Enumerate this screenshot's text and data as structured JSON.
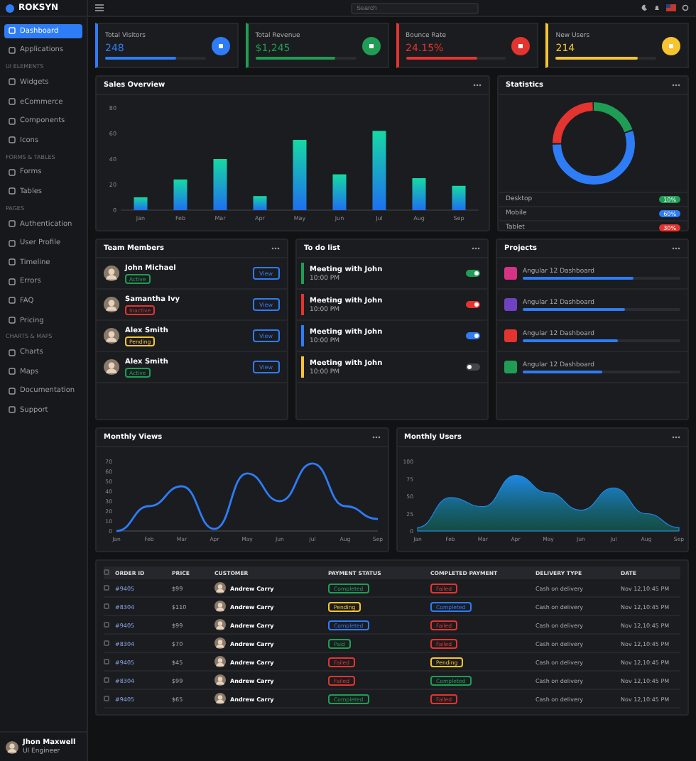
{
  "brand": "ROKSYN",
  "search": {
    "placeholder": "Search"
  },
  "sidebar": {
    "items": [
      {
        "kind": "item",
        "label": "Dashboard",
        "selected": true
      },
      {
        "kind": "item",
        "label": "Applications",
        "selected": false
      },
      {
        "kind": "section",
        "label": "UI ELEMENTS"
      },
      {
        "kind": "item",
        "label": "Widgets",
        "selected": false
      },
      {
        "kind": "item",
        "label": "eCommerce",
        "selected": false
      },
      {
        "kind": "item",
        "label": "Components",
        "selected": false
      },
      {
        "kind": "item",
        "label": "Icons",
        "selected": false
      },
      {
        "kind": "section",
        "label": "FORMS & TABLES"
      },
      {
        "kind": "item",
        "label": "Forms",
        "selected": false
      },
      {
        "kind": "item",
        "label": "Tables",
        "selected": false
      },
      {
        "kind": "section",
        "label": "PAGES"
      },
      {
        "kind": "item",
        "label": "Authentication",
        "selected": false
      },
      {
        "kind": "item",
        "label": "User Profile",
        "selected": false
      },
      {
        "kind": "item",
        "label": "Timeline",
        "selected": false
      },
      {
        "kind": "item",
        "label": "Errors",
        "selected": false
      },
      {
        "kind": "item",
        "label": "FAQ",
        "selected": false
      },
      {
        "kind": "item",
        "label": "Pricing",
        "selected": false
      },
      {
        "kind": "section",
        "label": "CHARTS & MAPS"
      },
      {
        "kind": "item",
        "label": "Charts",
        "selected": false
      },
      {
        "kind": "item",
        "label": "Maps",
        "selected": false
      },
      {
        "kind": "item",
        "label": "Documentation",
        "selected": false
      },
      {
        "kind": "item",
        "label": "Support",
        "selected": false
      }
    ],
    "user": {
      "name": "Jhon Maxwell",
      "role": "UI Engineer"
    }
  },
  "stats": [
    {
      "label": "Total Visitors",
      "value": "248",
      "color": "#2e7cf6",
      "level": 0.7
    },
    {
      "label": "Total Revenue",
      "value": "$1,245",
      "color": "#1f9d55",
      "level": 0.8
    },
    {
      "label": "Bounce Rate",
      "value": "24.15%",
      "color": "#e3342f",
      "level": 0.72
    },
    {
      "label": "New Users",
      "value": "214",
      "color": "#f6c431",
      "level": 0.82
    }
  ],
  "sales": {
    "title": "Sales Overview",
    "chart_data": {
      "type": "bar",
      "categories": [
        "Jan",
        "Feb",
        "Mar",
        "Apr",
        "May",
        "Jun",
        "Jul",
        "Aug",
        "Sep"
      ],
      "values": [
        10,
        24,
        40,
        11,
        55,
        28,
        62,
        25,
        19
      ],
      "ylim": [
        0,
        80
      ],
      "yticks": [
        0,
        20,
        40,
        60,
        80
      ]
    }
  },
  "statistics": {
    "title": "Statistics",
    "legend": [
      {
        "label": "Desktop",
        "badge": "10%",
        "color": "#1f9d55"
      },
      {
        "label": "Mobile",
        "badge": "60%",
        "color": "#2e7cf6"
      },
      {
        "label": "Tablet",
        "badge": "30%",
        "color": "#e3342f"
      }
    ]
  },
  "team": {
    "title": "Team Members",
    "members": [
      {
        "name": "John Michael",
        "status": "Active",
        "color": "#1f9d55",
        "action": "View"
      },
      {
        "name": "Samantha Ivy",
        "status": "Inactive",
        "color": "#e3342f",
        "action": "View"
      },
      {
        "name": "Alex Smith",
        "status": "Pending",
        "color": "#f6c431",
        "action": "View"
      },
      {
        "name": "Alex Smith",
        "status": "Active",
        "color": "#1f9d55",
        "action": "View"
      }
    ]
  },
  "todo": {
    "title": "To do list",
    "items": [
      {
        "title": "Meeting with John",
        "time": "10:00 PM",
        "color": "#1f9d55",
        "on": true
      },
      {
        "title": "Meeting with John",
        "time": "10:00 PM",
        "color": "#e3342f",
        "on": true
      },
      {
        "title": "Meeting with John",
        "time": "10:00 PM",
        "color": "#2e7cf6",
        "on": true
      },
      {
        "title": "Meeting with John",
        "time": "10:00 PM",
        "color": "#f6c431",
        "on": false
      }
    ]
  },
  "projects": {
    "title": "Projects",
    "items": [
      {
        "name": "Angular 12 Dashboard",
        "color": "#d63384",
        "level": 0.7
      },
      {
        "name": "Angular 12 Dashboard",
        "color": "#6f42c1",
        "level": 0.65
      },
      {
        "name": "Angular 12 Dashboard",
        "color": "#e3342f",
        "level": 0.6
      },
      {
        "name": "Angular 12 Dashboard",
        "color": "#1f9d55",
        "level": 0.5
      }
    ]
  },
  "views": {
    "title": "Monthly Views",
    "chart_data": {
      "type": "line",
      "categories": [
        "Jan",
        "Feb",
        "Mar",
        "Apr",
        "May",
        "Jun",
        "Jul",
        "Aug",
        "Sep"
      ],
      "series": [
        {
          "color": "#2e7cf6",
          "values": [
            0,
            25,
            45,
            2,
            58,
            30,
            68,
            25,
            12
          ]
        }
      ],
      "ylim": [
        0,
        70
      ],
      "yticks": [
        0,
        10,
        20,
        30,
        40,
        50,
        60,
        70
      ]
    }
  },
  "users": {
    "title": "Monthly Users",
    "chart_data": {
      "type": "area",
      "categories": [
        "Jan",
        "Feb",
        "Mar",
        "Apr",
        "May",
        "Jun",
        "Jul",
        "Aug",
        "Sep"
      ],
      "series": [
        {
          "color": "#1e88e5",
          "values": [
            5,
            48,
            35,
            80,
            55,
            30,
            62,
            25,
            5
          ]
        }
      ],
      "ylim": [
        0,
        100
      ],
      "yticks": [
        0,
        25,
        50,
        75,
        100
      ]
    }
  },
  "orders": {
    "all_checked": false,
    "columns": [
      "ORDER ID",
      "PRICE",
      "CUSTOMER",
      "PAYMENT STATUS",
      "COMPLETED PAYMENT",
      "DELIVERY TYPE",
      "DATE"
    ],
    "rows": [
      {
        "checked": false,
        "id": "#9405",
        "price": "$99",
        "customer": "Andrew Carry",
        "payment": {
          "label": "Completed",
          "color": "#1f9d55"
        },
        "completed": {
          "label": "Failed",
          "color": "#e3342f"
        },
        "delivery": "Cash on delivery",
        "date": "Nov 12,10:45 PM"
      },
      {
        "checked": false,
        "id": "#8304",
        "price": "$110",
        "customer": "Andrew Carry",
        "payment": {
          "label": "Pending",
          "color": "#f6c431"
        },
        "completed": {
          "label": "Completed",
          "color": "#2e7cf6"
        },
        "delivery": "Cash on delivery",
        "date": "Nov 12,10:45 PM"
      },
      {
        "checked": false,
        "id": "#9405",
        "price": "$99",
        "customer": "Andrew Carry",
        "payment": {
          "label": "Completed",
          "color": "#2e7cf6"
        },
        "completed": {
          "label": "Failed",
          "color": "#e3342f"
        },
        "delivery": "Cash on delivery",
        "date": "Nov 12,10:45 PM"
      },
      {
        "checked": false,
        "id": "#8304",
        "price": "$70",
        "customer": "Andrew Carry",
        "payment": {
          "label": "Paid",
          "color": "#1f9d55"
        },
        "completed": {
          "label": "Failed",
          "color": "#e3342f"
        },
        "delivery": "Cash on delivery",
        "date": "Nov 12,10:45 PM"
      },
      {
        "checked": false,
        "id": "#9405",
        "price": "$45",
        "customer": "Andrew Carry",
        "payment": {
          "label": "Failed",
          "color": "#e3342f"
        },
        "completed": {
          "label": "Pending",
          "color": "#f6c431"
        },
        "delivery": "Cash on delivery",
        "date": "Nov 12,10:45 PM"
      },
      {
        "checked": false,
        "id": "#8304",
        "price": "$99",
        "customer": "Andrew Carry",
        "payment": {
          "label": "Failed",
          "color": "#e3342f"
        },
        "completed": {
          "label": "Completed",
          "color": "#1f9d55"
        },
        "delivery": "Cash on delivery",
        "date": "Nov 12,10:45 PM"
      },
      {
        "checked": false,
        "id": "#9405",
        "price": "$65",
        "customer": "Andrew Carry",
        "payment": {
          "label": "Completed",
          "color": "#1f9d55"
        },
        "completed": {
          "label": "Failed",
          "color": "#e3342f"
        },
        "delivery": "Cash on delivery",
        "date": "Nov 12,10:45 PM"
      }
    ]
  }
}
